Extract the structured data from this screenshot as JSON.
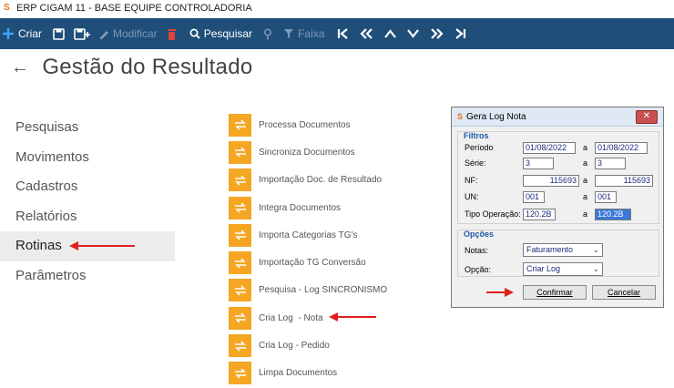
{
  "window": {
    "title": "ERP CIGAM 11 - BASE EQUIPE CONTROLADORIA"
  },
  "toolbar": {
    "criar": "Criar",
    "modificar": "Modificar",
    "pesquisar": "Pesquisar",
    "faixa": "Faixa"
  },
  "page": {
    "title": "Gestão do Resultado",
    "back": "←"
  },
  "nav": {
    "items": [
      "Pesquisas",
      "Movimentos",
      "Cadastros",
      "Relatórios",
      "Rotinas",
      "Parâmetros"
    ],
    "active": "Rotinas"
  },
  "routines": [
    "Processa Documentos",
    "Sincroniza Documentos",
    "Importação Doc. de Resultado",
    "Integra Documentos",
    "Importa Categorias TG's",
    "Importação TG Conversão",
    "Pesquisa - Log SINCRONISMO",
    "Cria Log  - Nota",
    "Cria Log - Pedido",
    "Limpa Documentos"
  ],
  "dialog": {
    "title": "Gera Log Nota",
    "filtros": {
      "title": "Filtros",
      "to": "a",
      "periodo": {
        "label": "Período",
        "from": "01/08/2022",
        "to": "01/08/2022"
      },
      "serie": {
        "label": "Série:",
        "from": "3",
        "to": "3"
      },
      "nf": {
        "label": "NF:",
        "from": "115693",
        "to": "115693"
      },
      "un": {
        "label": "UN:",
        "from": "001",
        "to": "001"
      },
      "tipo": {
        "label": "Tipo Operação:",
        "from": "120.2B",
        "to": "120.2B"
      }
    },
    "opcoes": {
      "title": "Opções",
      "notas": {
        "label": "Notas:",
        "value": "Faturamento"
      },
      "opcao": {
        "label": "Opção:",
        "value": "Criar Log"
      }
    },
    "confirmar": "Confirmar",
    "cancelar": "Cancelar"
  },
  "colors": {
    "toolbar": "#1f4e79",
    "routine_icon": "#f5a623",
    "annotation_arrow": "#e02020"
  }
}
